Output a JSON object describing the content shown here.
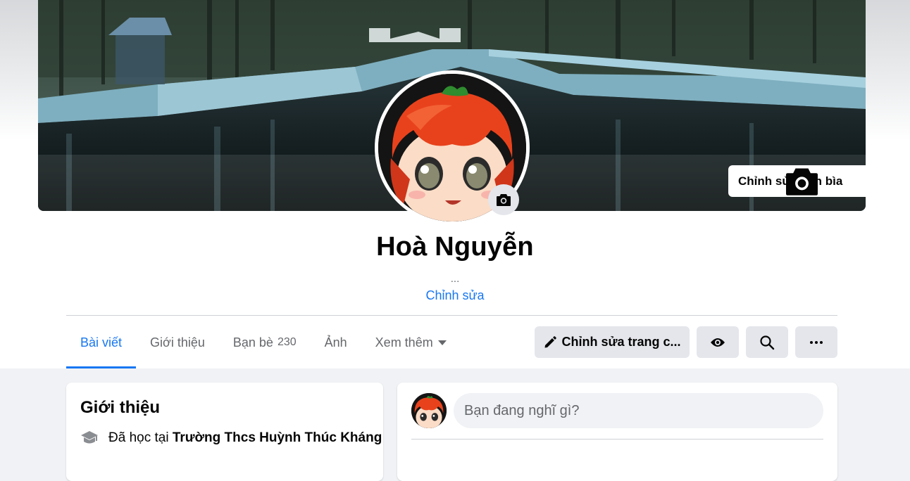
{
  "cover": {
    "edit_label": "Chỉnh sửa ảnh bìa"
  },
  "profile": {
    "name": "Hoà Nguyễn",
    "bio": "...",
    "edit_bio_label": "Chỉnh sửa"
  },
  "tabs": [
    {
      "label": "Bài viết",
      "active": true
    },
    {
      "label": "Giới thiệu"
    },
    {
      "label": "Bạn bè",
      "count": "230"
    },
    {
      "label": "Ảnh"
    },
    {
      "label": "Xem thêm",
      "icon": "caret-down-icon"
    }
  ],
  "actions": {
    "edit_profile_label": "Chỉnh sửa trang c...",
    "view_as_icon": "eye-icon",
    "search_icon": "search-icon",
    "more_icon": "more-icon"
  },
  "intro": {
    "title": "Giới thiệu",
    "items": [
      {
        "prefix": "Đã học tại",
        "school": "Trường Thcs Huỳnh Thúc Kháng",
        "icon": "graduation-cap-icon"
      }
    ]
  },
  "composer": {
    "placeholder": "Bạn đang nghĩ gì?"
  },
  "colors": {
    "accent": "#1877f2",
    "background": "#f0f2f5",
    "button_gray": "#e4e6eb",
    "avatar_hair": "#e8421c"
  }
}
